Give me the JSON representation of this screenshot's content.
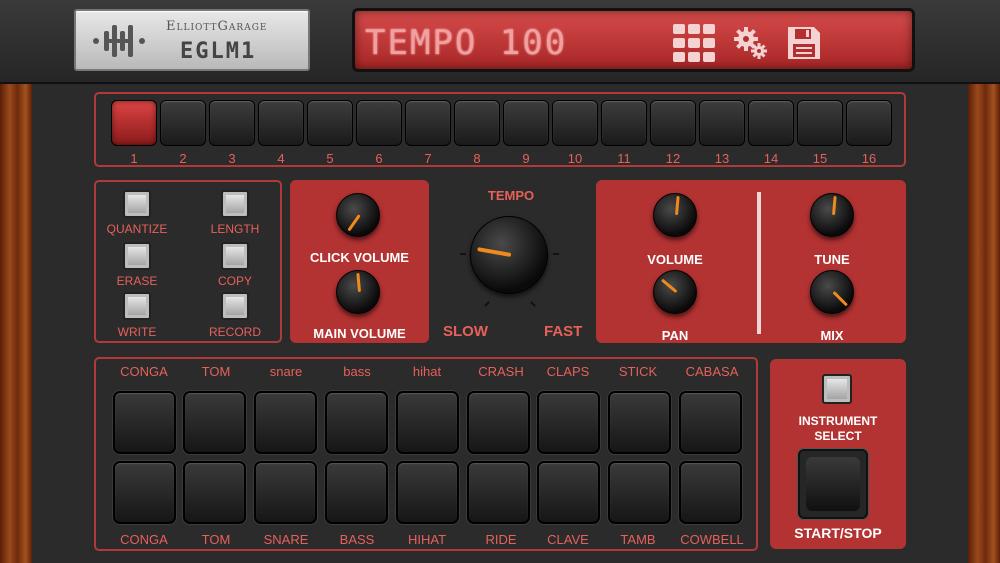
{
  "brand": {
    "name": "ElliottGarage",
    "model": "EGLM1"
  },
  "display": {
    "text": "TEMPO 100"
  },
  "toolbar": {
    "icons": [
      "grid-icon",
      "settings-gears-icon",
      "save-disk-icon"
    ]
  },
  "steps": {
    "numbers": [
      "1",
      "2",
      "3",
      "4",
      "5",
      "6",
      "7",
      "8",
      "9",
      "10",
      "11",
      "12",
      "13",
      "14",
      "15",
      "16"
    ],
    "active_index": 0
  },
  "functions": {
    "quantize": "QUANTIZE",
    "length": "LENGTH",
    "erase": "ERASE",
    "copy": "COPY",
    "write": "WRITE",
    "record": "RECORD"
  },
  "knobs": {
    "click_volume": "CLICK VOLUME",
    "main_volume": "MAIN VOLUME",
    "tempo": "TEMPO",
    "slow": "SLOW",
    "fast": "FAST",
    "volume": "VOLUME",
    "pan": "PAN",
    "tune": "TUNE",
    "mix": "MIX"
  },
  "pads": {
    "top_labels": [
      "CONGA",
      "TOM",
      "snare",
      "bass",
      "hihat",
      "CRASH",
      "CLAPS",
      "STICK",
      "CABASA"
    ],
    "bottom_labels": [
      "CONGA",
      "TOM",
      "SNARE",
      "BASS",
      "HIHAT",
      "RIDE",
      "CLAVE",
      "TAMB",
      "COWBELL"
    ]
  },
  "side": {
    "instrument_select_line1": "INSTRUMENT",
    "instrument_select_line2": "SELECT",
    "start_stop": "START/STOP"
  },
  "colors": {
    "accent": "#b33232",
    "label": "#e8605a",
    "lcd": "#c03a3a",
    "indicator": "#f08a1c"
  }
}
